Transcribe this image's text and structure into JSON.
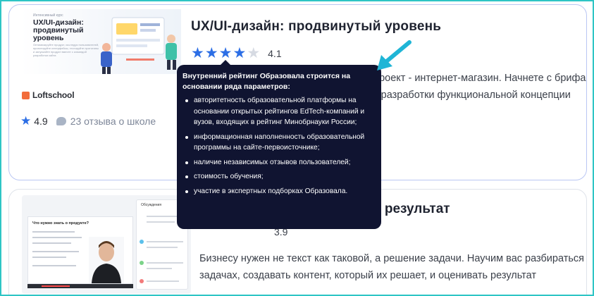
{
  "course1": {
    "cover": {
      "pretitle": "Интенсивный курс",
      "title": "UX/UI-дизайн: продвинутый уровень",
      "subtitle": "Оптимизируйте продукт, исследуя пользователей, проектируйте интерфейсы, тестируйте прототипы и запускайте продукт вместе с командой разработки сайта"
    },
    "school_logo": "Loftschool",
    "school_rating": "4.9",
    "school_reviews": "23 отзыва о школе",
    "title": "UX/UI-дизайн: продвинутый уровень",
    "rating": "4.1",
    "stars_filled": 4,
    "stars_total": 5,
    "description": "На практическом курсе вы выполните проект - интернет-магазин. Начнете с брифа с заказчиком и анализа конкурентов до разработки функциональной концепции проекта и добавления"
  },
  "course2": {
    "cover": {
      "slide_question": "Что нужно знать о продукте?",
      "chat_header": "Обсуждения"
    },
    "title": "Копирайтинг, который дает результат",
    "rating": "3.9",
    "description": "Бизнесу нужен не текст как таковой, а решение задачи. Научим вас разбираться в задачах, создавать контент, который их решает, и оценивать результат"
  },
  "tooltip": {
    "heading": "Внутренний рейтинг Образовала строится на основании ряда параметров:",
    "items": [
      "авторитетность образовательной платформы на основании открытых рейтингов EdTech-компаний и вузов, входящих в рейтинг Минобрнауки России;",
      "информационная наполненность образовательной программы на сайте-первоисточнике;",
      "наличие независимых отзывов пользователей;",
      "стоимость обучения;",
      "участие в экспертных подборках Образовала."
    ]
  },
  "colors": {
    "accent": "#2c6ee5",
    "tooltip_bg": "#101431",
    "frame": "#2ec5c5",
    "arrow": "#1fb5d6"
  }
}
